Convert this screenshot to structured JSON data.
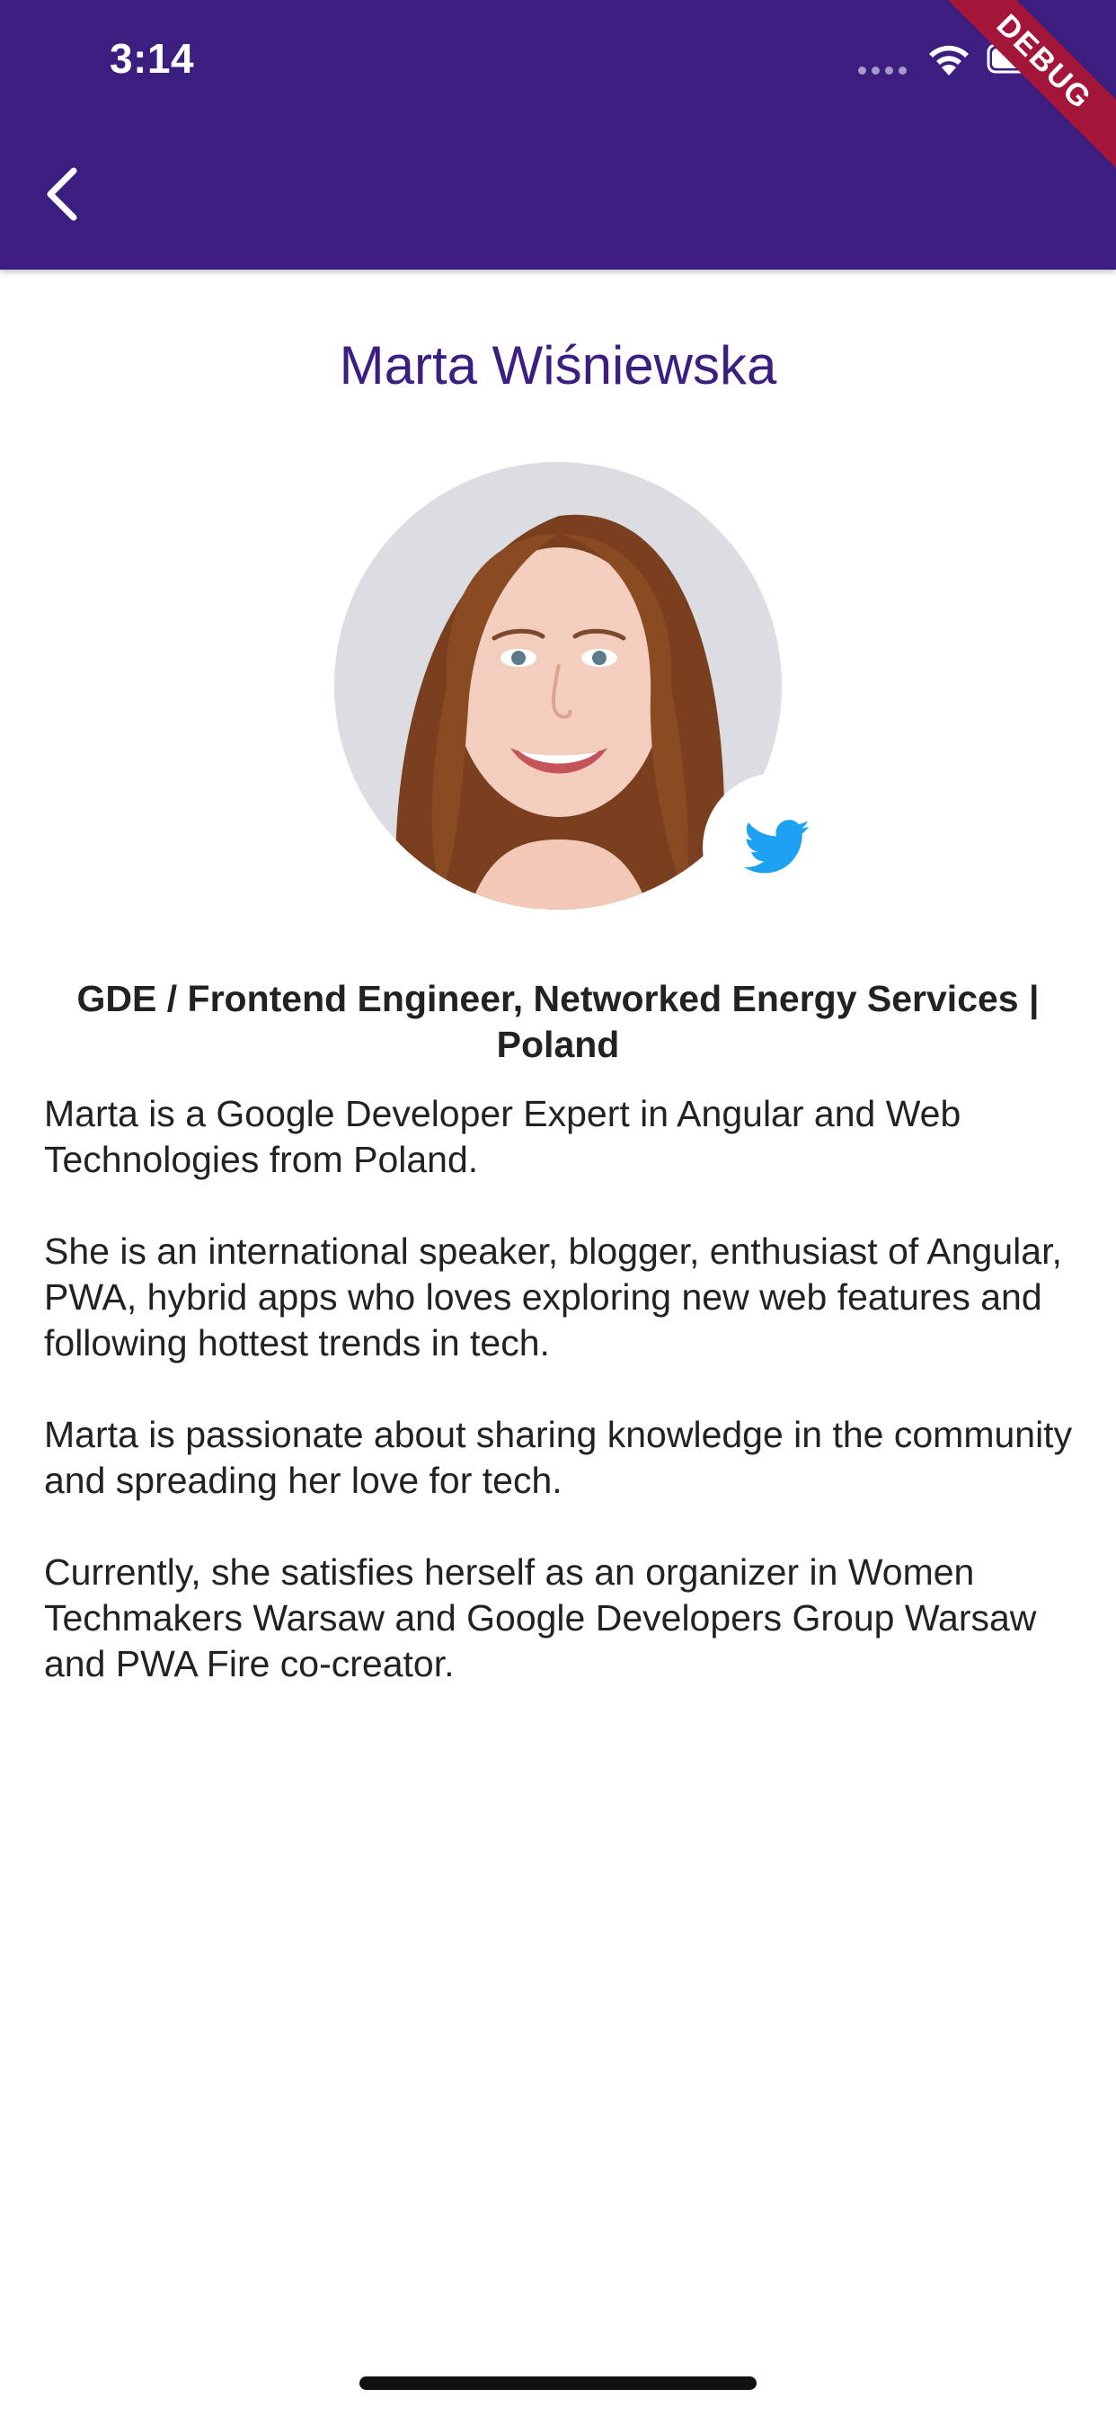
{
  "status_bar": {
    "time": "3:14"
  },
  "debug_banner": {
    "label": "DEBUG"
  },
  "speaker": {
    "name": "Marta Wiśniewska",
    "title": "GDE / Frontend Engineer, Networked Energy Services | Poland",
    "bio": [
      "Marta is a Google Developer Expert in Angular and Web Technologies from Poland.",
      "She is an international speaker, blogger, enthusiast of Angular, PWA, hybrid apps who loves exploring new web features and following hottest trends in tech.",
      "Marta is passionate about sharing knowledge in the community and spreading her love for tech.",
      "Currently, she satisfies herself as an organizer in Women Techmakers Warsaw and Google Developers Group Warsaw and PWA Fire co-creator."
    ]
  },
  "icons": {
    "back": "chevron-left-icon",
    "social": "twitter-icon"
  },
  "colors": {
    "app_bar": "#3c1e80",
    "name_text": "#3c1e80",
    "twitter_blue": "#1da1f2",
    "debug_banner": "#a3163a"
  }
}
